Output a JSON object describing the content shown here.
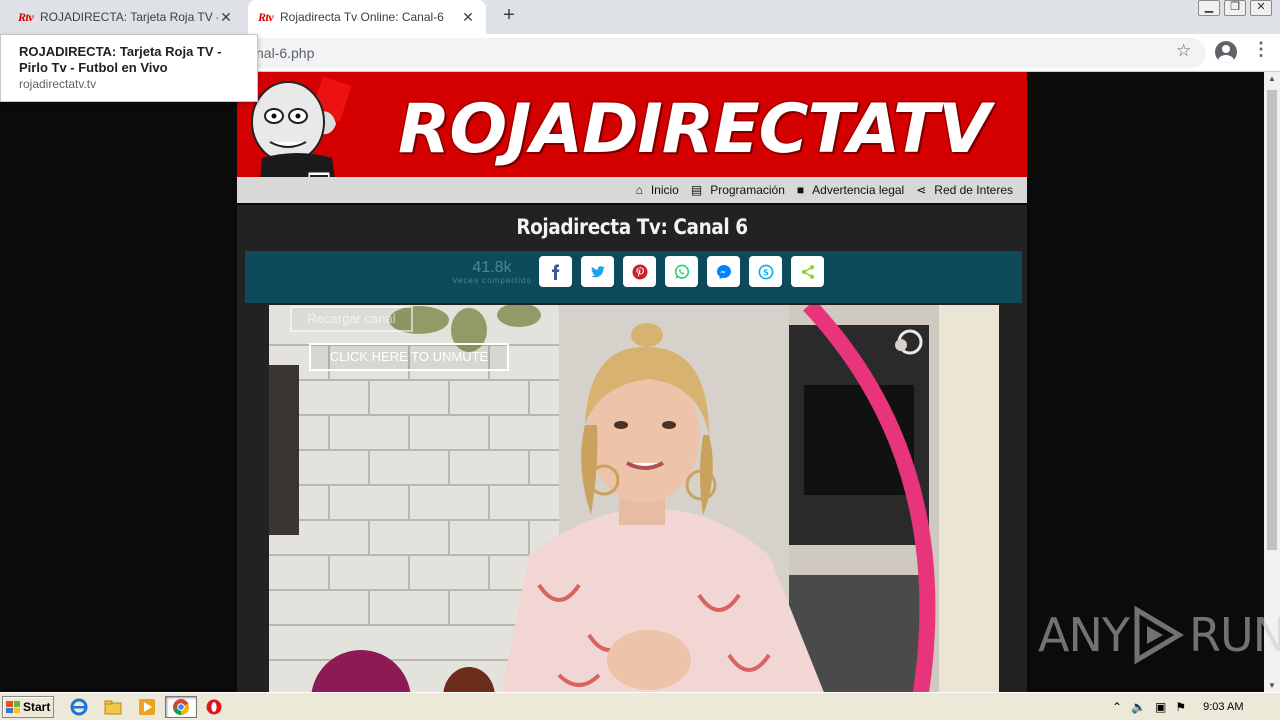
{
  "browser": {
    "tabs": [
      {
        "favicon": "Rtv",
        "title": "ROJADIRECTA: Tarjeta Roja TV - Pirlo",
        "active": false
      },
      {
        "favicon": "Rtv",
        "title": "Rojadirecta Tv Online: Canal-6",
        "active": true
      }
    ],
    "new_tab": "+",
    "url": "nal-6.php",
    "window_buttons": [
      "minimize",
      "restore",
      "close"
    ]
  },
  "tooltip": {
    "title": "ROJADIRECTA: Tarjeta Roja TV - Pirlo Tv - Futbol en Vivo",
    "host": "rojadirectatv.tv"
  },
  "site": {
    "logo": "ROJADIRECTATV",
    "nav": [
      {
        "icon": "home-icon",
        "label": "Inicio"
      },
      {
        "icon": "list-icon",
        "label": "Programación"
      },
      {
        "icon": "book-icon",
        "label": "Advertencia legal"
      },
      {
        "icon": "share-icon",
        "label": "Red de Interes"
      }
    ],
    "page_title": "Rojadirecta Tv: Canal 6",
    "share": {
      "count": "41.8k",
      "count_label": "Veces compartido",
      "buttons": [
        "facebook",
        "twitter",
        "pinterest",
        "whatsapp",
        "messenger",
        "skype",
        "share"
      ],
      "colors": {
        "facebook": "#3b5998",
        "twitter": "#1da1f2",
        "pinterest": "#cb2027",
        "whatsapp": "#25d366",
        "messenger": "#0084ff",
        "skype": "#00aff0",
        "share": "#95d03a"
      }
    },
    "video": {
      "reload_button": "Recargar canal",
      "unmute_button": "CLICK HERE TO UNMUTE"
    }
  },
  "watermark": {
    "left": "ANY",
    "right": "RUN"
  },
  "taskbar": {
    "start_label": "Start",
    "clock": "9:03 AM"
  }
}
